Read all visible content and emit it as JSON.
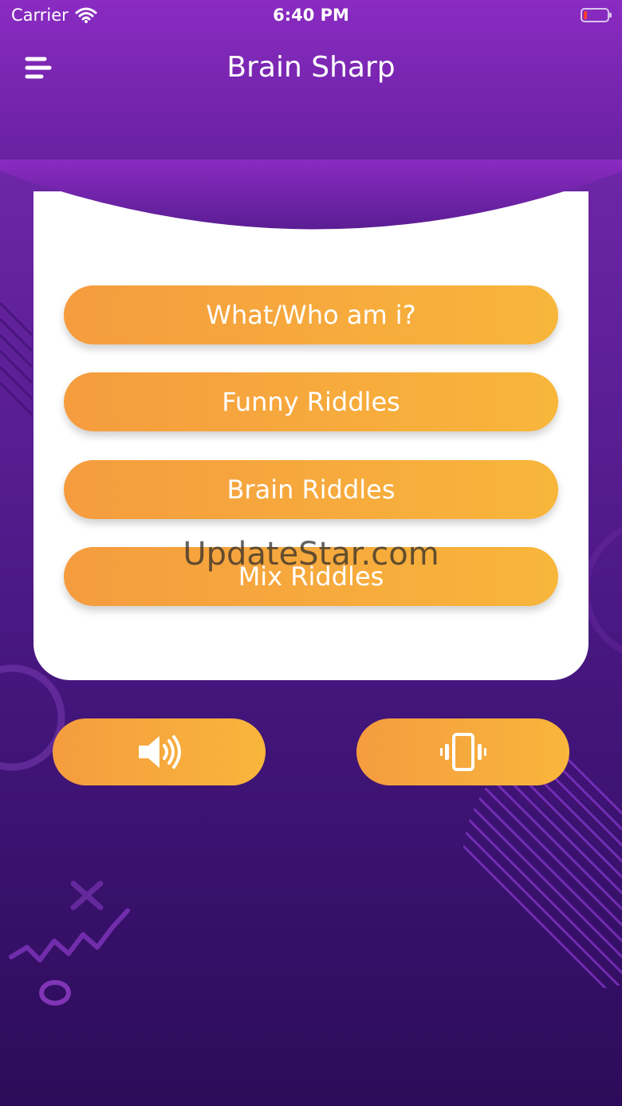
{
  "status_bar": {
    "carrier": "Carrier",
    "time": "6:40 PM"
  },
  "header": {
    "title": "Brain Sharp"
  },
  "menu": {
    "options": [
      {
        "label": "What/Who am i?"
      },
      {
        "label": "Funny Riddles"
      },
      {
        "label": "Brain Riddles"
      },
      {
        "label": "Mix Riddles"
      }
    ]
  },
  "controls": {
    "sound_icon": "speaker-icon",
    "vibrate_icon": "vibrate-icon"
  },
  "watermark": "UpdateStar.com",
  "colors": {
    "background_top": "#7a2cb3",
    "background_bottom": "#2c0c59",
    "button_start": "#f59c3f",
    "button_end": "#f8b63b"
  }
}
